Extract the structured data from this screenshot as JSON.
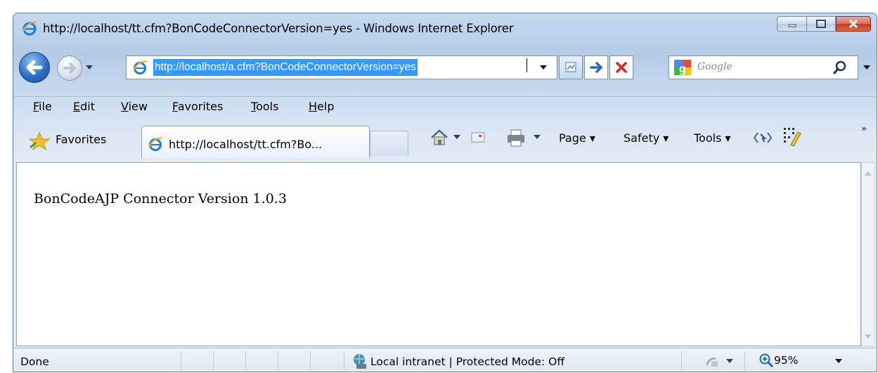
{
  "window": {
    "title": "http://localhost/tt.cfm?BonCodeConnectorVersion=yes - Windows Internet Explorer"
  },
  "address": {
    "url": "http://localhost/a.cfm?BonCodeConnectorVersion=yes"
  },
  "search": {
    "placeholder": "Google"
  },
  "menu": {
    "items": [
      "File",
      "Edit",
      "View",
      "Favorites",
      "Tools",
      "Help"
    ]
  },
  "favorites": {
    "label": "Favorites"
  },
  "tab": {
    "label": "http://localhost/tt.cfm?Bo..."
  },
  "commands": {
    "page": "Page",
    "safety": "Safety",
    "tools": "Tools"
  },
  "page": {
    "body_text": "BonCodeAJP Connector Version 1.0.3"
  },
  "status": {
    "text": "Done",
    "zone": "Local intranet | Protected Mode: Off",
    "zoom": "95%"
  }
}
